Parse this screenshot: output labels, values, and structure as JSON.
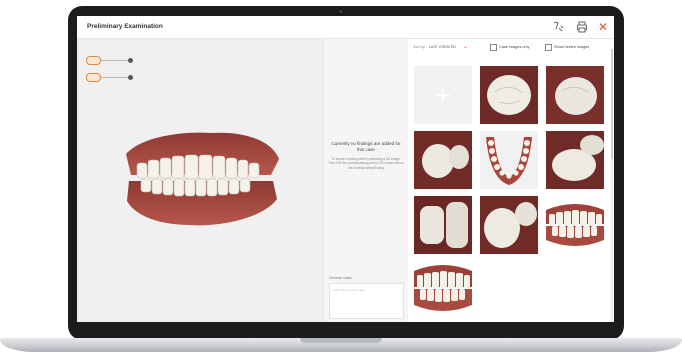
{
  "app": {
    "title": "Preliminary Examination"
  },
  "toolbar": {
    "tooth_tool_icon": "tooth-settings-icon",
    "print_icon": "print-icon",
    "close_icon": "close-icon",
    "close_glyph": "✕"
  },
  "findings": {
    "title": "Currently no findings are added for this case",
    "instructions": "To create a finding start by selecting a 3D image. Then Ctrl the corresponding point in 3D scene and on the corresponding finding",
    "notes_label": "General notes",
    "notes_placeholder": "Click here to add a note"
  },
  "gallery": {
    "sort_label": "Sort by:",
    "sort_value": "LAST CREATED",
    "option_case_images": "Case Images only",
    "option_hidden_images": "Show hidden images",
    "add_glyph": "+"
  },
  "colors": {
    "accent": "#e2543b",
    "tool_orange": "#e6873d"
  }
}
